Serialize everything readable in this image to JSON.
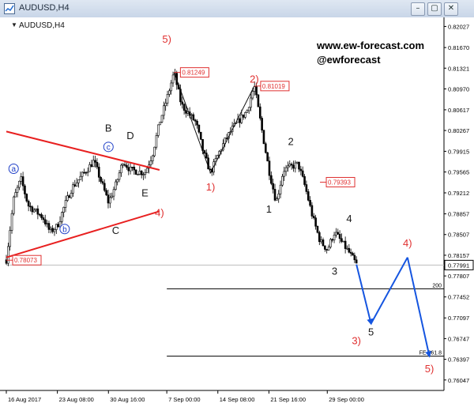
{
  "window": {
    "title": "AUDUSD,H4",
    "buttons": {
      "minimize": "–",
      "restore": "▢",
      "close": "✕"
    }
  },
  "chart_header": {
    "symbol_label": "AUDUSD,H4",
    "dropdown_glyph": "▼"
  },
  "watermark": {
    "site": "www.ew-forecast.com",
    "handle": "@ewforecast"
  },
  "chart_data": {
    "type": "candlestick",
    "title": "AUDUSD,H4",
    "price_axis": {
      "tick_labels": [
        "0.82027",
        "0.81670",
        "0.81321",
        "0.80970",
        "0.80617",
        "0.80267",
        "0.79915",
        "0.79565",
        "0.79212",
        "0.78857",
        "0.78507",
        "0.78157",
        "0.77991",
        "0.77807",
        "0.77452",
        "0.77097",
        "0.76747",
        "0.76397",
        "0.76047"
      ],
      "current_price": "0.77991",
      "range": [
        0.7587,
        0.8218
      ]
    },
    "time_axis": {
      "tick_labels": [
        "16 Aug 2017",
        "23 Aug 08:00",
        "30 Aug 16:00",
        "7 Sep 00:00",
        "14 Sep 08:00",
        "21 Sep 16:00",
        "29 Sep 00:00"
      ]
    },
    "price_path": [
      {
        "date": "16 Aug 2017",
        "price": 0.7808
      },
      {
        "date": "17 Aug",
        "price": 0.791
      },
      {
        "date": "18 Aug",
        "price": 0.7945
      },
      {
        "date": "19 Aug",
        "price": 0.79
      },
      {
        "date": "21 Aug",
        "price": 0.788
      },
      {
        "date": "22 Aug",
        "price": 0.7855
      },
      {
        "date": "23 Aug",
        "price": 0.7865
      },
      {
        "date": "24 Aug",
        "price": 0.79
      },
      {
        "date": "25 Aug",
        "price": 0.793
      },
      {
        "date": "28 Aug",
        "price": 0.7975
      },
      {
        "date": "29 Aug",
        "price": 0.794
      },
      {
        "date": "30 Aug",
        "price": 0.7905
      },
      {
        "date": "31 Aug",
        "price": 0.7935
      },
      {
        "date": "1 Sep",
        "price": 0.7975
      },
      {
        "date": "2 Sep",
        "price": 0.796
      },
      {
        "date": "4 Sep",
        "price": 0.7955
      },
      {
        "date": "5 Sep",
        "price": 0.7985
      },
      {
        "date": "6 Sep",
        "price": 0.804
      },
      {
        "date": "7 Sep",
        "price": 0.808
      },
      {
        "date": "8 Sep",
        "price": 0.8125
      },
      {
        "date": "9 Sep",
        "price": 0.807
      },
      {
        "date": "11 Sep",
        "price": 0.804
      },
      {
        "date": "12 Sep",
        "price": 0.799
      },
      {
        "date": "13 Sep",
        "price": 0.7955
      },
      {
        "date": "14 Sep",
        "price": 0.7985
      },
      {
        "date": "15 Sep",
        "price": 0.801
      },
      {
        "date": "16 Sep",
        "price": 0.803
      },
      {
        "date": "18 Sep",
        "price": 0.806
      },
      {
        "date": "19 Sep",
        "price": 0.8102
      },
      {
        "date": "20 Sep",
        "price": 0.803
      },
      {
        "date": "21 Sep",
        "price": 0.796
      },
      {
        "date": "22 Sep",
        "price": 0.7905
      },
      {
        "date": "23 Sep",
        "price": 0.796
      },
      {
        "date": "25 Sep",
        "price": 0.797
      },
      {
        "date": "26 Sep",
        "price": 0.793
      },
      {
        "date": "27 Sep",
        "price": 0.788
      },
      {
        "date": "28 Sep",
        "price": 0.784
      },
      {
        "date": "29 Sep",
        "price": 0.7825
      },
      {
        "date": "30 Sep",
        "price": 0.7855
      },
      {
        "date": "2 Oct",
        "price": 0.782
      },
      {
        "date": "3 Oct",
        "price": 0.78
      }
    ],
    "price_flags": [
      {
        "label": "0.81249",
        "date": "8 Sep",
        "price": 0.81249
      },
      {
        "label": "0.81019",
        "date": "19 Sep",
        "price": 0.81019
      },
      {
        "label": "0.79393",
        "date": "28 Sep",
        "price": 0.79393
      },
      {
        "label": "0.78073",
        "date": "16 Aug 2017",
        "price": 0.78073
      }
    ],
    "levels": [
      {
        "label": "200",
        "price": 0.7759,
        "from_date": "7 Sep"
      },
      {
        "label": "FE 261.8",
        "price": 0.7645,
        "from_date": "7 Sep"
      }
    ],
    "triangle_lines": [
      {
        "from": {
          "date": "16 Aug 2017",
          "price": 0.8025
        },
        "to": {
          "date": "6 Sep",
          "price": 0.796
        }
      },
      {
        "from": {
          "date": "16 Aug 2017",
          "price": 0.7812
        },
        "to": {
          "date": "6 Sep",
          "price": 0.789
        }
      }
    ],
    "corrective_path": [
      {
        "date": "8 Sep",
        "price": 0.8125
      },
      {
        "date": "13 Sep",
        "price": 0.7955
      },
      {
        "date": "19 Sep",
        "price": 0.8102
      }
    ],
    "projection_path": [
      {
        "date": "3 Oct",
        "price": 0.78
      },
      {
        "date": "5 Oct",
        "price": 0.77
      },
      {
        "date": "10 Oct",
        "price": 0.7812
      },
      {
        "date": "13 Oct",
        "price": 0.7645
      }
    ],
    "wave_labels": [
      {
        "text": "5)",
        "color": "#e03030",
        "date": "7 Sep",
        "price": 0.8175
      },
      {
        "text": "2)",
        "color": "#e03030",
        "date": "19 Sep",
        "price": 0.8108
      },
      {
        "text": "1)",
        "color": "#e03030",
        "date": "13 Sep",
        "price": 0.7925
      },
      {
        "text": "4)",
        "color": "#e03030",
        "date": "6 Sep",
        "price": 0.7882
      },
      {
        "text": "3)",
        "color": "#e03030",
        "date": "3 Oct",
        "price": 0.7665
      },
      {
        "text": "4)",
        "color": "#e03030",
        "date": "10 Oct",
        "price": 0.783
      },
      {
        "text": "5)",
        "color": "#e03030",
        "date": "13 Oct",
        "price": 0.7618
      },
      {
        "text": "B",
        "color": "#1a1a1a",
        "date": "30 Aug",
        "price": 0.8025
      },
      {
        "text": "D",
        "color": "#1a1a1a",
        "date": "2 Sep",
        "price": 0.8012
      },
      {
        "text": "E",
        "color": "#1a1a1a",
        "date": "4 Sep",
        "price": 0.7915
      },
      {
        "text": "C",
        "color": "#1a1a1a",
        "date": "31 Aug",
        "price": 0.7852
      },
      {
        "text": "1",
        "color": "#1a1a1a",
        "date": "21 Sep",
        "price": 0.7888
      },
      {
        "text": "2",
        "color": "#1a1a1a",
        "date": "24 Sep",
        "price": 0.8002
      },
      {
        "text": "3",
        "color": "#1a1a1a",
        "date": "30 Sep",
        "price": 0.7783
      },
      {
        "text": "4",
        "color": "#1a1a1a",
        "date": "2 Oct",
        "price": 0.7872
      },
      {
        "text": "5",
        "color": "#1a1a1a",
        "date": "5 Oct",
        "price": 0.768
      }
    ],
    "circle_labels": [
      {
        "text": "a",
        "date": "17 Aug",
        "price": 0.7962
      },
      {
        "text": "c",
        "date": "30 Aug",
        "price": 0.7999
      },
      {
        "text": "b",
        "date": "24 Aug",
        "price": 0.786
      }
    ],
    "colors": {
      "bull": "#ffffff",
      "bear": "#000000",
      "triangle": "#e82020",
      "projection": "#1555e0",
      "corrective": "#111111",
      "flag": "#e03030",
      "circle": "#2040c8"
    }
  }
}
